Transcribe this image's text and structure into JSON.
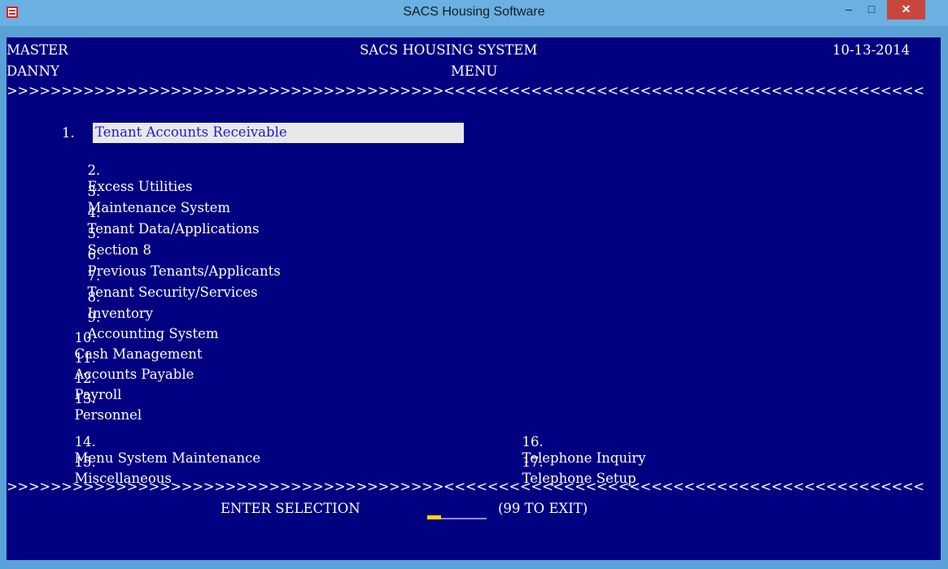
{
  "window": {
    "title": "SACS Housing Software",
    "minimize_glyph": "‒",
    "maximize_glyph": "□",
    "close_glyph": "✕"
  },
  "header": {
    "left_top": "MASTER",
    "center_top": "SACS HOUSING SYSTEM",
    "right_top": "10-13-2014",
    "left_second": "DANNY",
    "center_second": "MENU"
  },
  "separator": ">>>>>>>>>>>>>>>>>>>>>>>>>>>>>>>>>>>>>>>><<<<<<<<<<<<<<<<<<<<<<<<<<<<<<<<<<<<<<<<<<<<",
  "menu": {
    "items": [
      {
        "num": "1.",
        "label": "Tenant Accounts Receivable"
      },
      {
        "num": "2.",
        "label": "Excess Utilities"
      },
      {
        "num": "3.",
        "label": "Maintenance System"
      },
      {
        "num": "4.",
        "label": "Tenant Data/Applications"
      },
      {
        "num": "5.",
        "label": "Section 8"
      },
      {
        "num": "6.",
        "label": "Previous Tenants/Applicants"
      },
      {
        "num": "7.",
        "label": "Tenant Security/Services"
      },
      {
        "num": "8.",
        "label": "Inventory"
      },
      {
        "num": "9.",
        "label": "Accounting System"
      },
      {
        "num": "10.",
        "label": "Cash Management"
      },
      {
        "num": "11.",
        "label": "Accounts Payable"
      },
      {
        "num": "12.",
        "label": "Payroll"
      },
      {
        "num": "13.",
        "label": "Personnel"
      },
      {
        "num": "14.",
        "label": "Menu System Maintenance"
      },
      {
        "num": "15.",
        "label": "Miscellaneous"
      },
      {
        "num": "16.",
        "label": "Telephone Inquiry"
      },
      {
        "num": "17.",
        "label": "Telephone Setup"
      }
    ]
  },
  "prompt": {
    "label": "ENTER SELECTION",
    "value": "",
    "hint": "(99 TO EXIT)"
  },
  "colors": {
    "console_bg": "#000080",
    "text": "#ffffff",
    "highlight_bg": "#e8e8e8",
    "highlight_text": "#1b1bd6",
    "cursor": "#ffd900"
  }
}
